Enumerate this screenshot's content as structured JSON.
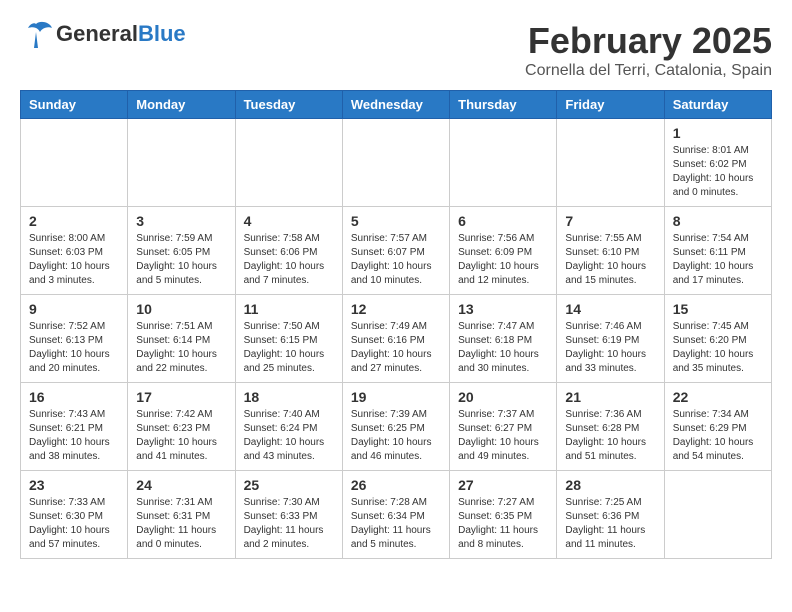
{
  "header": {
    "logo_general": "General",
    "logo_blue": "Blue",
    "month_title": "February 2025",
    "location": "Cornella del Terri, Catalonia, Spain"
  },
  "days_of_week": [
    "Sunday",
    "Monday",
    "Tuesday",
    "Wednesday",
    "Thursday",
    "Friday",
    "Saturday"
  ],
  "weeks": [
    [
      {
        "day": "",
        "info": ""
      },
      {
        "day": "",
        "info": ""
      },
      {
        "day": "",
        "info": ""
      },
      {
        "day": "",
        "info": ""
      },
      {
        "day": "",
        "info": ""
      },
      {
        "day": "",
        "info": ""
      },
      {
        "day": "1",
        "info": "Sunrise: 8:01 AM\nSunset: 6:02 PM\nDaylight: 10 hours and 0 minutes."
      }
    ],
    [
      {
        "day": "2",
        "info": "Sunrise: 8:00 AM\nSunset: 6:03 PM\nDaylight: 10 hours and 3 minutes."
      },
      {
        "day": "3",
        "info": "Sunrise: 7:59 AM\nSunset: 6:05 PM\nDaylight: 10 hours and 5 minutes."
      },
      {
        "day": "4",
        "info": "Sunrise: 7:58 AM\nSunset: 6:06 PM\nDaylight: 10 hours and 7 minutes."
      },
      {
        "day": "5",
        "info": "Sunrise: 7:57 AM\nSunset: 6:07 PM\nDaylight: 10 hours and 10 minutes."
      },
      {
        "day": "6",
        "info": "Sunrise: 7:56 AM\nSunset: 6:09 PM\nDaylight: 10 hours and 12 minutes."
      },
      {
        "day": "7",
        "info": "Sunrise: 7:55 AM\nSunset: 6:10 PM\nDaylight: 10 hours and 15 minutes."
      },
      {
        "day": "8",
        "info": "Sunrise: 7:54 AM\nSunset: 6:11 PM\nDaylight: 10 hours and 17 minutes."
      }
    ],
    [
      {
        "day": "9",
        "info": "Sunrise: 7:52 AM\nSunset: 6:13 PM\nDaylight: 10 hours and 20 minutes."
      },
      {
        "day": "10",
        "info": "Sunrise: 7:51 AM\nSunset: 6:14 PM\nDaylight: 10 hours and 22 minutes."
      },
      {
        "day": "11",
        "info": "Sunrise: 7:50 AM\nSunset: 6:15 PM\nDaylight: 10 hours and 25 minutes."
      },
      {
        "day": "12",
        "info": "Sunrise: 7:49 AM\nSunset: 6:16 PM\nDaylight: 10 hours and 27 minutes."
      },
      {
        "day": "13",
        "info": "Sunrise: 7:47 AM\nSunset: 6:18 PM\nDaylight: 10 hours and 30 minutes."
      },
      {
        "day": "14",
        "info": "Sunrise: 7:46 AM\nSunset: 6:19 PM\nDaylight: 10 hours and 33 minutes."
      },
      {
        "day": "15",
        "info": "Sunrise: 7:45 AM\nSunset: 6:20 PM\nDaylight: 10 hours and 35 minutes."
      }
    ],
    [
      {
        "day": "16",
        "info": "Sunrise: 7:43 AM\nSunset: 6:21 PM\nDaylight: 10 hours and 38 minutes."
      },
      {
        "day": "17",
        "info": "Sunrise: 7:42 AM\nSunset: 6:23 PM\nDaylight: 10 hours and 41 minutes."
      },
      {
        "day": "18",
        "info": "Sunrise: 7:40 AM\nSunset: 6:24 PM\nDaylight: 10 hours and 43 minutes."
      },
      {
        "day": "19",
        "info": "Sunrise: 7:39 AM\nSunset: 6:25 PM\nDaylight: 10 hours and 46 minutes."
      },
      {
        "day": "20",
        "info": "Sunrise: 7:37 AM\nSunset: 6:27 PM\nDaylight: 10 hours and 49 minutes."
      },
      {
        "day": "21",
        "info": "Sunrise: 7:36 AM\nSunset: 6:28 PM\nDaylight: 10 hours and 51 minutes."
      },
      {
        "day": "22",
        "info": "Sunrise: 7:34 AM\nSunset: 6:29 PM\nDaylight: 10 hours and 54 minutes."
      }
    ],
    [
      {
        "day": "23",
        "info": "Sunrise: 7:33 AM\nSunset: 6:30 PM\nDaylight: 10 hours and 57 minutes."
      },
      {
        "day": "24",
        "info": "Sunrise: 7:31 AM\nSunset: 6:31 PM\nDaylight: 11 hours and 0 minutes."
      },
      {
        "day": "25",
        "info": "Sunrise: 7:30 AM\nSunset: 6:33 PM\nDaylight: 11 hours and 2 minutes."
      },
      {
        "day": "26",
        "info": "Sunrise: 7:28 AM\nSunset: 6:34 PM\nDaylight: 11 hours and 5 minutes."
      },
      {
        "day": "27",
        "info": "Sunrise: 7:27 AM\nSunset: 6:35 PM\nDaylight: 11 hours and 8 minutes."
      },
      {
        "day": "28",
        "info": "Sunrise: 7:25 AM\nSunset: 6:36 PM\nDaylight: 11 hours and 11 minutes."
      },
      {
        "day": "",
        "info": ""
      }
    ]
  ]
}
